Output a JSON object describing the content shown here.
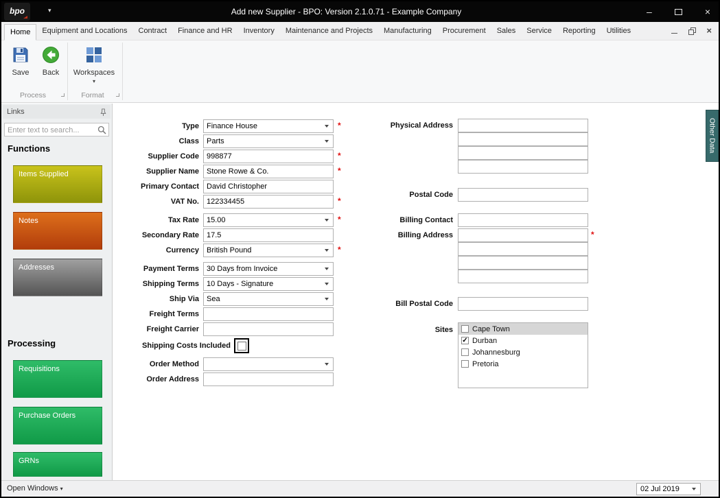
{
  "window": {
    "title": "Add new Supplier - BPO: Version 2.1.0.71 - Example Company",
    "logo_text": "bpo"
  },
  "tabs": [
    "Home",
    "Equipment and Locations",
    "Contract",
    "Finance and HR",
    "Inventory",
    "Maintenance and Projects",
    "Manufacturing",
    "Procurement",
    "Sales",
    "Service",
    "Reporting",
    "Utilities"
  ],
  "active_tab": "Home",
  "ribbon": {
    "save_label": "Save",
    "back_label": "Back",
    "workspaces_label": "Workspaces",
    "groups": [
      "Process",
      "Format"
    ]
  },
  "icons": {
    "save": "floppy-disk",
    "back": "green-left-arrow-circle",
    "workspaces": "blue-window-grid",
    "search": "magnifier",
    "links_pin": "pushpin",
    "dropdown": "caret-down"
  },
  "sidebar": {
    "title": "Links",
    "search_placeholder": "Enter text to search...",
    "functions_heading": "Functions",
    "processing_heading": "Processing",
    "function_buttons": [
      {
        "label": "Items Supplied",
        "color_from": "#c9c31b",
        "color_to": "#8e940a"
      },
      {
        "label": "Notes",
        "color_from": "#dd6f1b",
        "color_to": "#b23d0b"
      },
      {
        "label": "Addresses",
        "color_from": "#a0a0a0",
        "color_to": "#545454"
      }
    ],
    "processing_buttons": [
      {
        "label": "Requisitions",
        "color_from": "#2fbc68",
        "color_to": "#109a47"
      },
      {
        "label": "Purchase Orders",
        "color_from": "#2fbc68",
        "color_to": "#109a47"
      },
      {
        "label": "GRNs",
        "color_from": "#2fbc68",
        "color_to": "#109a47"
      }
    ]
  },
  "form": {
    "required_marker": "*",
    "left_fields": [
      {
        "label": "Type",
        "value": "Finance House",
        "kind": "combo",
        "required": true
      },
      {
        "label": "Class",
        "value": "Parts",
        "kind": "combo",
        "required": false
      },
      {
        "label": "Supplier Code",
        "value": "998877",
        "kind": "text",
        "required": true
      },
      {
        "label": "Supplier Name",
        "value": "Stone Rowe & Co.",
        "kind": "text",
        "required": true
      },
      {
        "label": "Primary Contact",
        "value": "David Christopher",
        "kind": "text",
        "required": false
      },
      {
        "label": "VAT No.",
        "value": "122334455",
        "kind": "text",
        "required": true
      },
      {
        "label": "Tax Rate",
        "value": "15.00",
        "kind": "combo",
        "required": true
      },
      {
        "label": "Secondary Rate",
        "value": "17.5",
        "kind": "text",
        "required": false
      },
      {
        "label": "Currency",
        "value": "British Pound",
        "kind": "combo",
        "required": true
      },
      {
        "label": "Payment Terms",
        "value": "30 Days from Invoice",
        "kind": "combo",
        "required": false
      },
      {
        "label": "Shipping Terms",
        "value": "10 Days - Signature",
        "kind": "combo",
        "required": false
      },
      {
        "label": "Ship Via",
        "value": "Sea",
        "kind": "combo",
        "required": false
      },
      {
        "label": "Freight Terms",
        "value": "",
        "kind": "text",
        "required": false
      },
      {
        "label": "Freight Carrier",
        "value": "",
        "kind": "text",
        "required": false
      },
      {
        "label": "Shipping Costs Included",
        "kind": "checkbox",
        "checked": false,
        "required": false
      },
      {
        "label": "Order Method",
        "value": "",
        "kind": "combo",
        "required": false
      },
      {
        "label": "Order Address",
        "value": "",
        "kind": "text",
        "required": false
      }
    ],
    "right_column": {
      "groups": [
        {
          "label": "Physical Address",
          "values": [
            "",
            "",
            "",
            ""
          ],
          "required": false
        },
        {
          "label": "Postal Code",
          "values": [
            ""
          ],
          "required": false
        },
        {
          "label": "Billing Contact",
          "values": [
            ""
          ],
          "required": false
        },
        {
          "label": "Billing Address",
          "values": [
            "",
            "",
            "",
            ""
          ],
          "required": true
        },
        {
          "label": "Bill Postal Code",
          "values": [
            ""
          ],
          "required": false
        }
      ]
    },
    "sites": {
      "label": "Sites",
      "options": [
        {
          "label": "Cape Town",
          "checked": false,
          "highlighted": true
        },
        {
          "label": "Durban",
          "checked": true,
          "highlighted": false
        },
        {
          "label": "Johannesburg",
          "checked": false,
          "highlighted": false
        },
        {
          "label": "Pretoria",
          "checked": false,
          "highlighted": false
        }
      ]
    }
  },
  "other_data_tab": "Other Data",
  "statusbar": {
    "open_windows_label": "Open Windows",
    "date_value": "02 Jul 2019"
  }
}
